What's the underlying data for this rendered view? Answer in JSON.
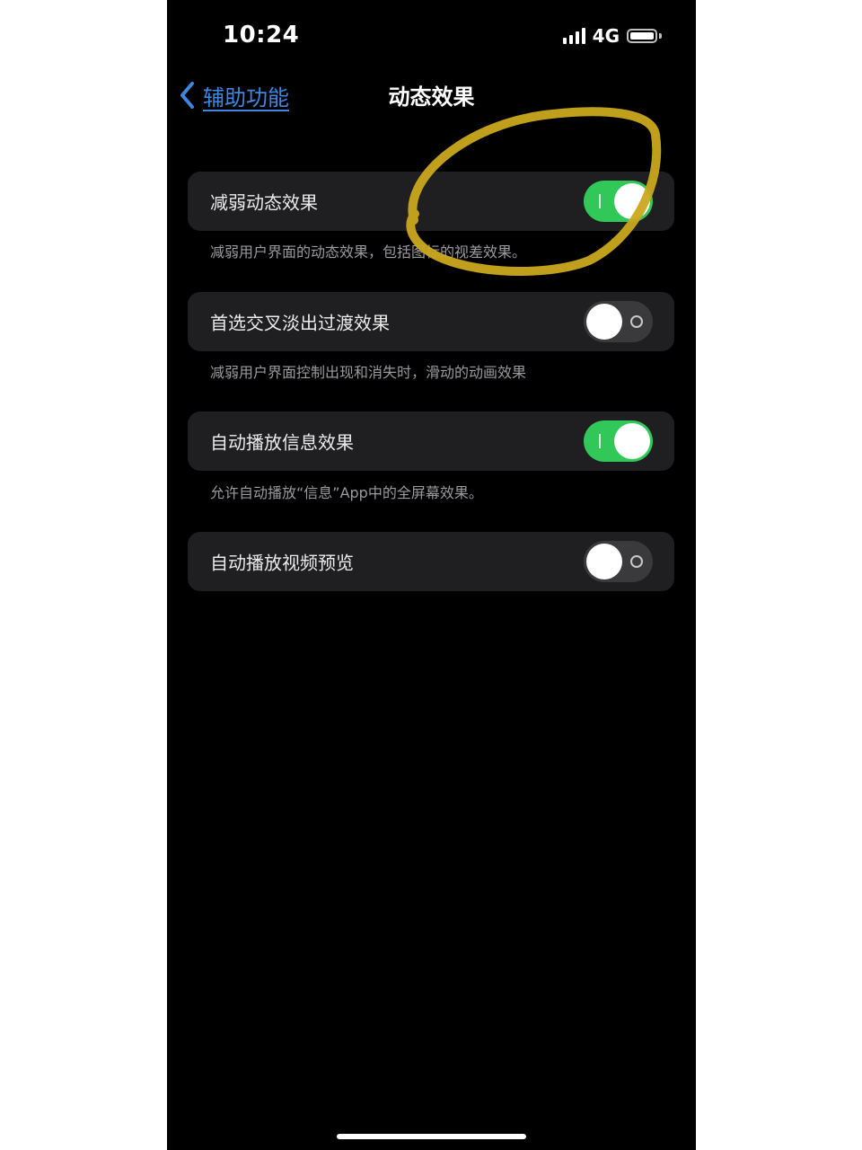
{
  "status_bar": {
    "time": "10:24",
    "network": "4G",
    "signal_icon": "signal-bars-icon",
    "battery_icon": "battery-icon"
  },
  "nav": {
    "back_label": "辅助功能",
    "back_icon": "chevron-left-icon",
    "title": "动态效果"
  },
  "settings": [
    {
      "label": "减弱动态效果",
      "on": true,
      "footer": "减弱用户界面的动态效果，包括图标的视差效果。"
    },
    {
      "label": "首选交叉淡出过渡效果",
      "on": false,
      "footer": "减弱用户界面控制出现和消失时，滑动的动画效果"
    },
    {
      "label": "自动播放信息效果",
      "on": true,
      "footer": "允许自动播放“信息”App中的全屏幕效果。"
    },
    {
      "label": "自动播放视频预览",
      "on": false,
      "footer": ""
    }
  ],
  "colors": {
    "background": "#000000",
    "group": "#1f1f21",
    "toggle_on": "#32c759",
    "toggle_off": "#3a3a3d",
    "link": "#3f86e0",
    "annotation": "#c9a81c"
  }
}
